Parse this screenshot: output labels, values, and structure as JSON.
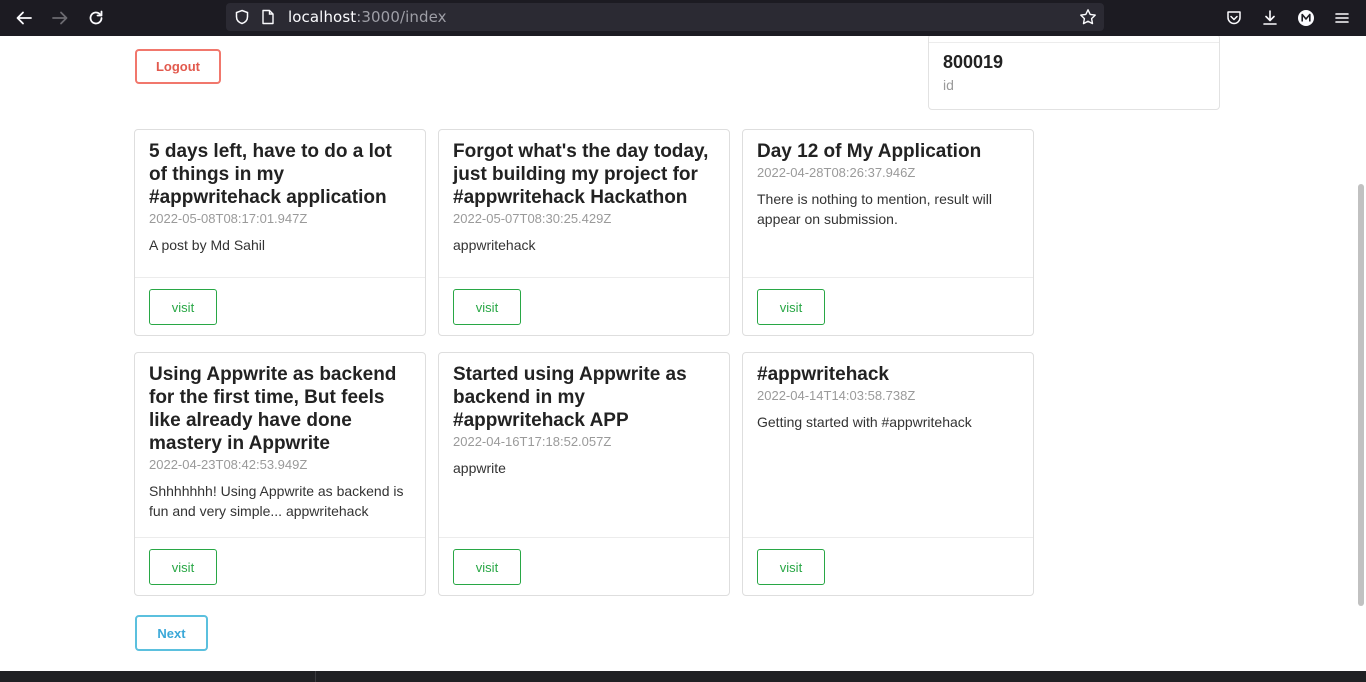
{
  "browser": {
    "url_host": "localhost",
    "url_rest": ":3000/index"
  },
  "page": {
    "logout_label": "Logout",
    "next_label": "Next",
    "id_card": {
      "value": "800019",
      "label": "id"
    },
    "visit_label": "visit",
    "posts": [
      {
        "title": "5 days left, have to do a lot of things in my #appwritehack application",
        "date": "2022-05-08T08:17:01.947Z",
        "text": "A post by Md Sahil"
      },
      {
        "title": "Forgot what's the day today, just building my project for #appwritehack Hackathon",
        "date": "2022-05-07T08:30:25.429Z",
        "text": "appwritehack"
      },
      {
        "title": "Day 12 of My Application",
        "date": "2022-04-28T08:26:37.946Z",
        "text": "There is nothing to mention, result will appear on submission."
      },
      {
        "title": "Using Appwrite as backend for the first time, But feels like already have done mastery in Appwrite",
        "date": "2022-04-23T08:42:53.949Z",
        "text": "Shhhhhhh! Using Appwrite as backend is fun and very simple... appwritehack"
      },
      {
        "title": "Started using Appwrite as backend in my #appwritehack APP",
        "date": "2022-04-16T17:18:52.057Z",
        "text": "appwrite"
      },
      {
        "title": "#appwritehack",
        "date": "2022-04-14T14:03:58.738Z",
        "text": "Getting started with #appwritehack"
      }
    ]
  }
}
